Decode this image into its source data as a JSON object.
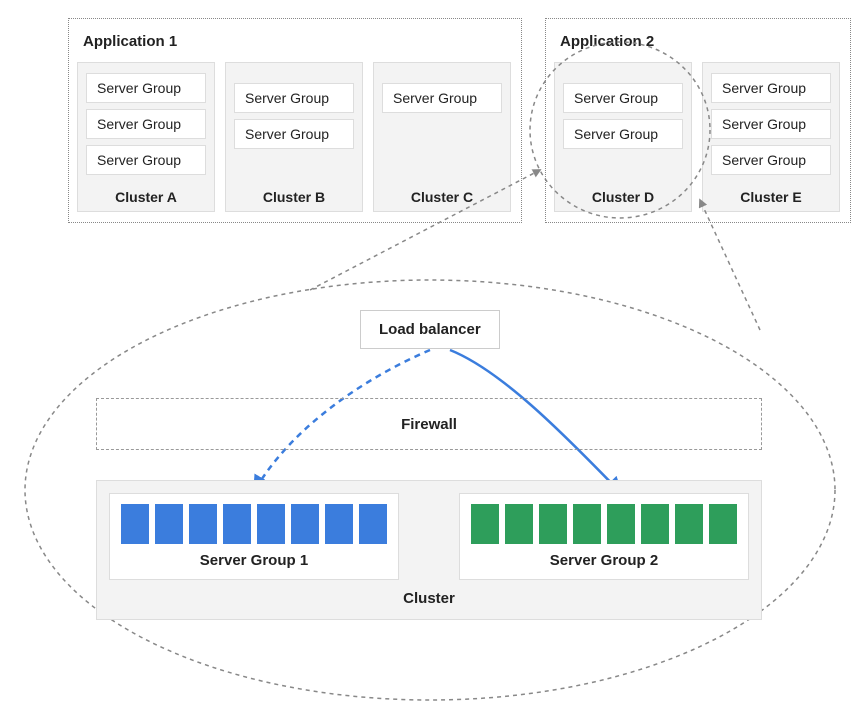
{
  "applications": [
    {
      "title": "Application 1",
      "clusters": [
        {
          "name": "Cluster A",
          "server_groups": [
            "Server Group",
            "Server Group",
            "Server Group"
          ]
        },
        {
          "name": "Cluster B",
          "server_groups": [
            "Server Group",
            "Server Group"
          ]
        },
        {
          "name": "Cluster C",
          "server_groups": [
            "Server Group"
          ]
        }
      ]
    },
    {
      "title": "Application 2",
      "clusters": [
        {
          "name": "Cluster D",
          "server_groups": [
            "Server Group",
            "Server Group"
          ]
        },
        {
          "name": "Cluster E",
          "server_groups": [
            "Server Group",
            "Server Group",
            "Server Group"
          ]
        }
      ]
    }
  ],
  "detail": {
    "load_balancer_label": "Load balancer",
    "firewall_label": "Firewall",
    "cluster_label": "Cluster",
    "server_groups": [
      {
        "label": "Server Group 1",
        "color": "blue",
        "count": 8
      },
      {
        "label": "Server Group 2",
        "color": "green",
        "count": 8
      }
    ]
  }
}
